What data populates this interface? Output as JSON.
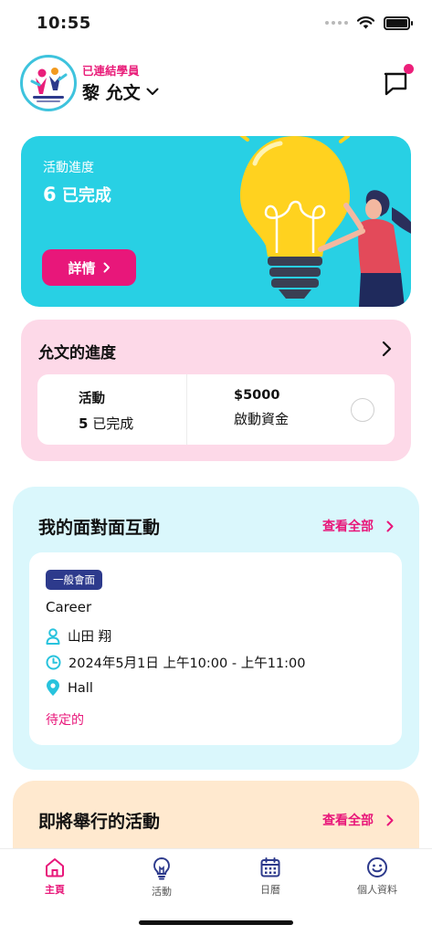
{
  "status_bar": {
    "time": "10:55"
  },
  "header": {
    "linked_label": "已連結學員",
    "student_name": "黎 允文"
  },
  "progress_card": {
    "title": "活動進度",
    "count": "6",
    "count_suffix": "已完成",
    "button_label": "詳情"
  },
  "child_progress": {
    "title": "允文的進度",
    "activity_label": "活動",
    "activity_count": "5",
    "activity_suffix": "已完成",
    "fund_amount": "$5000",
    "fund_label": "啟動資金"
  },
  "face_to_face": {
    "title": "我的面對面互動",
    "see_all": "查看全部",
    "meeting": {
      "tag": "一般會面",
      "title": "Career",
      "person": "山田 翔",
      "datetime": "2024年5月1日 上午10:00 - 上午11:00",
      "location": "Hall",
      "status": "待定的"
    }
  },
  "upcoming": {
    "title": "即將舉行的活動",
    "see_all": "查看全部"
  },
  "tabs": [
    {
      "label": "主頁",
      "icon": "home-icon",
      "active": true
    },
    {
      "label": "活動",
      "icon": "lightbulb-icon",
      "active": false
    },
    {
      "label": "日曆",
      "icon": "calendar-icon",
      "active": false
    },
    {
      "label": "個人資料",
      "icon": "smiley-icon",
      "active": false
    }
  ],
  "colors": {
    "accent": "#e8177a",
    "hero_bg": "#28d0e4",
    "child_bg": "#fdd9e8",
    "f2f_bg": "#daf7fc",
    "upcoming_bg": "#ffe9cf",
    "tag_bg": "#2d3a8c"
  }
}
